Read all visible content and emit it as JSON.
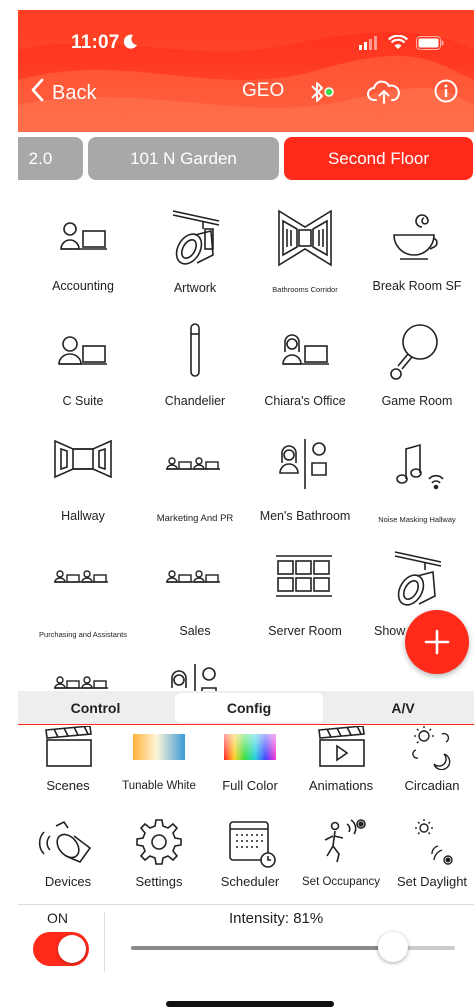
{
  "status": {
    "time": "11:07"
  },
  "nav": {
    "back_label": "Back",
    "geo_label": "GEO"
  },
  "location_tabs": [
    {
      "label": "2.0"
    },
    {
      "label": "101 N Garden"
    },
    {
      "label": "Second Floor",
      "active": true
    }
  ],
  "rooms": [
    {
      "label": "Accounting",
      "icon": "desk-person-icon"
    },
    {
      "label": "Artwork",
      "icon": "spotlight-icon"
    },
    {
      "label": "Bathrooms Corridor",
      "icon": "corridor-icon"
    },
    {
      "label": "Break Room SF",
      "icon": "coffee-cup-icon"
    },
    {
      "label": "C Suite",
      "icon": "desk-person-icon"
    },
    {
      "label": "Chandelier",
      "icon": "chandelier-icon"
    },
    {
      "label": "Chiara's Office",
      "icon": "desk-woman-icon"
    },
    {
      "label": "Game Room",
      "icon": "ping-pong-icon"
    },
    {
      "label": "Hallway",
      "icon": "hallway-icon"
    },
    {
      "label": "Marketing And PR",
      "icon": "team-desks-icon"
    },
    {
      "label": "Men's Bathroom",
      "icon": "restroom-icon"
    },
    {
      "label": "Noise Masking Hallway",
      "icon": "music-note-icon"
    },
    {
      "label": "Purchasing and Assistants",
      "icon": "team-desks-icon"
    },
    {
      "label": "Sales",
      "icon": "team-desks-icon"
    },
    {
      "label": "Server Room",
      "icon": "server-rack-icon"
    },
    {
      "label": "Show",
      "icon": "spotlight-icon"
    },
    {
      "label": "",
      "icon": "team-desks-icon"
    },
    {
      "label": "",
      "icon": "restroom-icon"
    }
  ],
  "mode_tabs": [
    {
      "label": "Control"
    },
    {
      "label": "Config",
      "active": true
    },
    {
      "label": "A/V"
    }
  ],
  "tools": [
    {
      "label": "Scenes",
      "icon": "clapperboard-icon"
    },
    {
      "label": "Tunable White",
      "icon": "tunable-white-icon"
    },
    {
      "label": "Full Color",
      "icon": "full-color-icon"
    },
    {
      "label": "Animations",
      "icon": "animation-icon"
    },
    {
      "label": "Circadian",
      "icon": "circadian-icon"
    },
    {
      "label": "Devices",
      "icon": "devices-icon"
    },
    {
      "label": "Settings",
      "icon": "gear-icon"
    },
    {
      "label": "Scheduler",
      "icon": "calendar-clock-icon"
    },
    {
      "label": "Set Occupancy",
      "icon": "occupancy-icon"
    },
    {
      "label": "Set Daylight",
      "icon": "daylight-icon"
    }
  ],
  "power": {
    "label": "ON",
    "on": true
  },
  "intensity": {
    "label": "Intensity:  81%",
    "value_percent": 81
  },
  "colors": {
    "accent": "#ff2a1a",
    "header": "#ff3a22"
  }
}
